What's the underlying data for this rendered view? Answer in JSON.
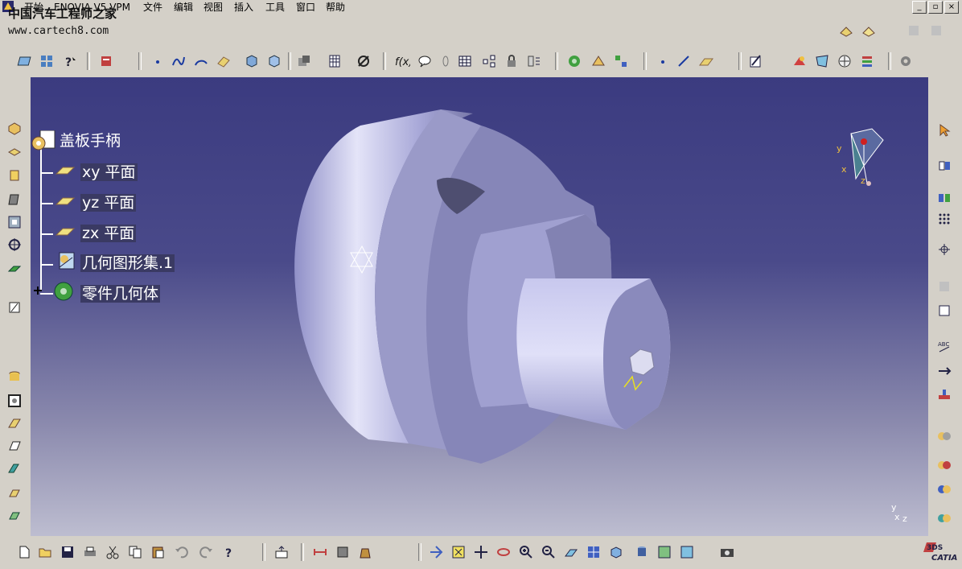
{
  "menu": {
    "items": [
      "开始",
      "ENOVIA V5 VPM",
      "文件",
      "编辑",
      "视图",
      "插入",
      "工具",
      "窗口",
      "帮助"
    ]
  },
  "watermark": {
    "chinese": "中国汽车工程师之家",
    "url": "www.cartech8.com"
  },
  "window_buttons": [
    "_",
    "▫",
    "×"
  ],
  "tree": {
    "root": "盖板手柄",
    "items": [
      {
        "label": "xy 平面",
        "icon": "plane-icon"
      },
      {
        "label": "yz 平面",
        "icon": "plane-icon"
      },
      {
        "label": "zx 平面",
        "icon": "plane-icon"
      },
      {
        "label": "几何图形集.1",
        "icon": "geometric-set-icon"
      },
      {
        "label": "零件几何体",
        "icon": "part-body-icon"
      }
    ]
  },
  "compass": {
    "x": "x",
    "y": "y",
    "z": "z"
  },
  "axis_triad": {
    "x": "x",
    "y": "y",
    "z": "z"
  },
  "brand": {
    "logo": "CATIA",
    "ds": "3DS"
  },
  "colors": {
    "bg_top": "#3b3b80",
    "bg_bottom": "#bdbdd0",
    "part": "#b8b8e6",
    "toolbar": "#d4d0c8"
  }
}
